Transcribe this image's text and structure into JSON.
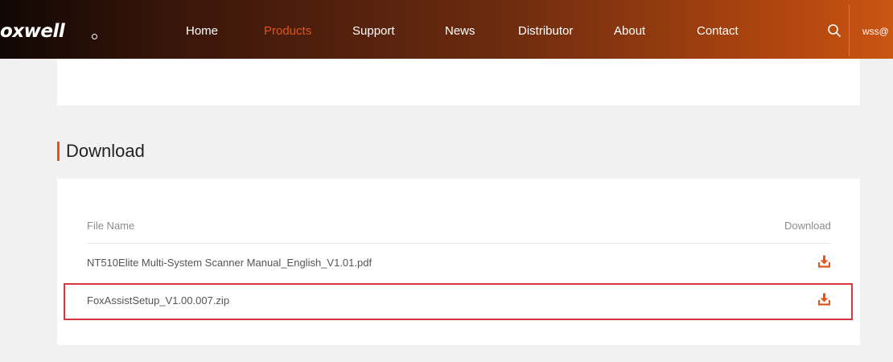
{
  "brand": {
    "logo_text": "oxwell"
  },
  "nav": {
    "items": [
      {
        "label": "Home"
      },
      {
        "label": "Products",
        "active": true
      },
      {
        "label": "Support"
      },
      {
        "label": "News"
      },
      {
        "label": "Distributor"
      },
      {
        "label": "About"
      },
      {
        "label": "Contact"
      }
    ],
    "search_icon": "search-icon",
    "user_text": "wss@"
  },
  "download": {
    "title": "Download",
    "columns": {
      "file_name": "File Name",
      "download": "Download"
    },
    "files": [
      {
        "name": "NT510Elite Multi-System Scanner Manual_English_V1.01.pdf",
        "icon": "download-icon"
      },
      {
        "name": "FoxAssistSetup_V1.00.007.zip",
        "icon": "download-icon",
        "highlighted": true
      }
    ]
  },
  "colors": {
    "accent": "#e2561d",
    "highlight_border": "#d9363e",
    "nav_gradient_start": "#110703",
    "nav_gradient_end": "#cb5512",
    "page_bg": "#f1f1f1"
  }
}
